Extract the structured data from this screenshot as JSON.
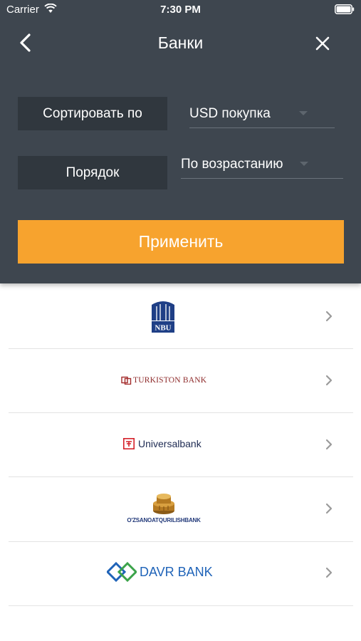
{
  "status_bar": {
    "carrier": "Carrier",
    "time": "7:30 PM",
    "wifi_icon": "wifi-icon",
    "battery_icon": "battery-icon"
  },
  "nav": {
    "title": "Банки",
    "back_icon": "chevron-left-icon",
    "close_icon": "close-icon"
  },
  "filters": {
    "sort_label": "Сортировать по",
    "sort_value": "USD покупка",
    "order_label": "Порядок",
    "order_value": "По возрастанию"
  },
  "apply_label": "Применить",
  "colors": {
    "header_bg": "#3e464f",
    "label_bg": "#30373e",
    "accent": "#f7a32e",
    "list_bg": "#ffffff"
  },
  "banks": [
    {
      "name": "NBU",
      "logo_text": "NBU"
    },
    {
      "name": "Turkiston Bank",
      "logo_text": "TURKISTON BANK"
    },
    {
      "name": "Universalbank",
      "logo_text": "Universalbank"
    },
    {
      "name": "O'zsanoatqurilishbank",
      "logo_text": "O'ZSANOATQURILISHBANK"
    },
    {
      "name": "Davr Bank",
      "logo_text": "DAVR BANK"
    }
  ]
}
